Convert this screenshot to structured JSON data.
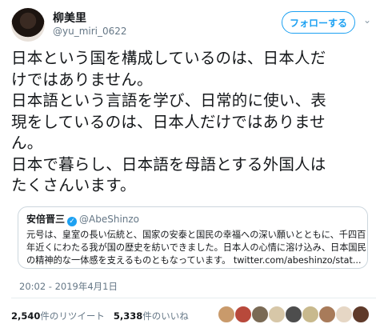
{
  "user": {
    "name": "柳美里",
    "handle": "@yu_miri_0622"
  },
  "follow_label": "フォローする",
  "tweet_lines": [
    "日本という国を構成しているのは、日本人だ",
    "けではありません。",
    "日本語という言語を学び、日常的に使い、表",
    "現をしているのは、日本人だけではありませ",
    "ん。",
    "日本で暮らし、日本語を母語とする外国人は",
    "たくさんいます。"
  ],
  "quote": {
    "name": "安倍晋三",
    "handle": "@AbeShinzo",
    "verified_icon": "verified-badge-icon",
    "lines": [
      "元号は、皇室の長い伝統と、国家の安泰と国民の幸福への深い願いとともに、千四百",
      "年近くにわたる我が国の歴史を紡いできました。日本人の心情に溶け込み、日本国民",
      "の精神的な一体感を支えるものともなっています。 twitter.com/abeshinzo/stat..."
    ]
  },
  "timestamp": "20:02 - 2019年4月1日",
  "stats": {
    "retweets_count": "2,540",
    "retweets_label": "件のリツイート",
    "likes_count": "5,338",
    "likes_label": "件のいいね"
  },
  "likers_colors": [
    "#c99a6b",
    "#b8493b",
    "#7a6a55",
    "#d7c7a8",
    "#4d4d4d",
    "#c8b98d",
    "#a87b5a",
    "#e6d7c5",
    "#5f3a2a"
  ],
  "accent_color": "#1da1f2"
}
